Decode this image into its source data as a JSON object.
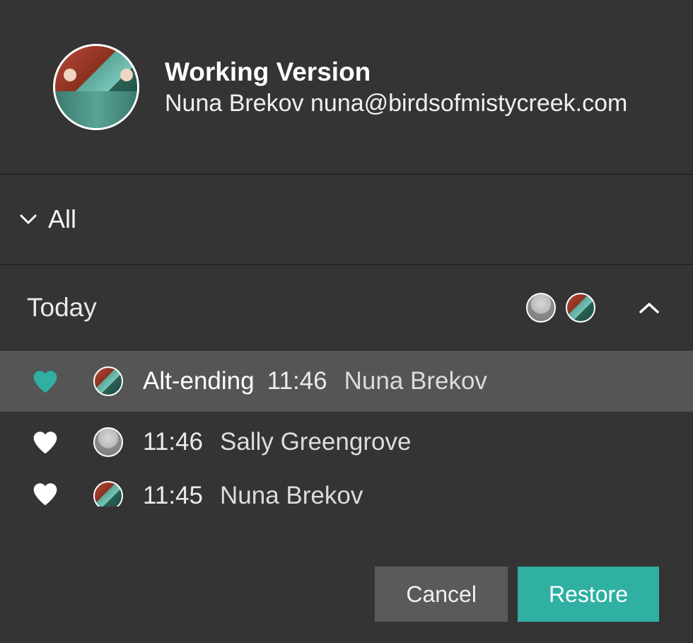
{
  "header": {
    "title": "Working Version",
    "user_name": "Nuna Brekov",
    "user_email": "nuna@birdsofmistycreek.com"
  },
  "filter": {
    "label": "All"
  },
  "day": {
    "label": "Today"
  },
  "versions": [
    {
      "favorite": true,
      "favorite_color": "#2fb0a3",
      "name": "Alt-ending",
      "time": "11:46",
      "author": "Nuna Brekov",
      "avatar": "nuna",
      "selected": true
    },
    {
      "favorite": false,
      "favorite_color": "#ffffff",
      "name": "",
      "time": "11:46",
      "author": "Sally Greengrove",
      "avatar": "sally",
      "selected": false
    },
    {
      "favorite": false,
      "favorite_color": "#ffffff",
      "name": "",
      "time": "11:45",
      "author": "Nuna Brekov",
      "avatar": "nuna",
      "selected": false
    }
  ],
  "buttons": {
    "cancel": "Cancel",
    "restore": "Restore"
  }
}
